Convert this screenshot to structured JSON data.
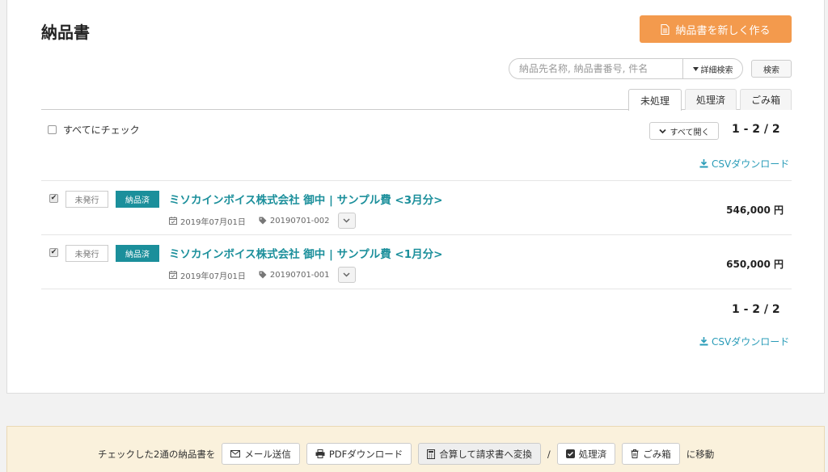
{
  "page": {
    "title": "納品書",
    "new_button": "納品書を新しく作る"
  },
  "search": {
    "placeholder": "納品先名称, 納品書番号, 件名",
    "advanced_label": "詳細検索",
    "button_label": "検索"
  },
  "tabs": [
    {
      "label": "未処理",
      "active": true
    },
    {
      "label": "処理済",
      "active": false
    },
    {
      "label": "ごみ箱",
      "active": false
    }
  ],
  "list": {
    "check_all_label": "すべてにチェック",
    "expand_all_label": "すべて開く",
    "pager": "1 - 2 / 2",
    "csv_label": "CSVダウンロード",
    "items": [
      {
        "checked": true,
        "issue_status": "未発行",
        "delivery_status": "納品済",
        "subject": "ミソカインボイス株式会社 御中 | サンプル費 <3月分>",
        "date": "2019年07月01日",
        "number": "20190701-002",
        "amount": "546,000 円"
      },
      {
        "checked": true,
        "issue_status": "未発行",
        "delivery_status": "納品済",
        "subject": "ミソカインボイス株式会社 御中 | サンプル費 <1月分>",
        "date": "2019年07月01日",
        "number": "20190701-001",
        "amount": "650,000 円"
      }
    ]
  },
  "footer": {
    "prefix": "チェックした2通の納品書を",
    "mail_label": "メール送信",
    "pdf_label": "PDFダウンロード",
    "merge_label": "合算して請求書へ変換",
    "separator": "/",
    "processed_label": "処理済",
    "trash_label": "ごみ箱",
    "suffix": "に移動"
  },
  "colors": {
    "accent_orange": "#f39a4d",
    "teal": "#1b8f9b",
    "link_blue": "#2a9cb8",
    "footer_bg": "#faf1dc"
  }
}
